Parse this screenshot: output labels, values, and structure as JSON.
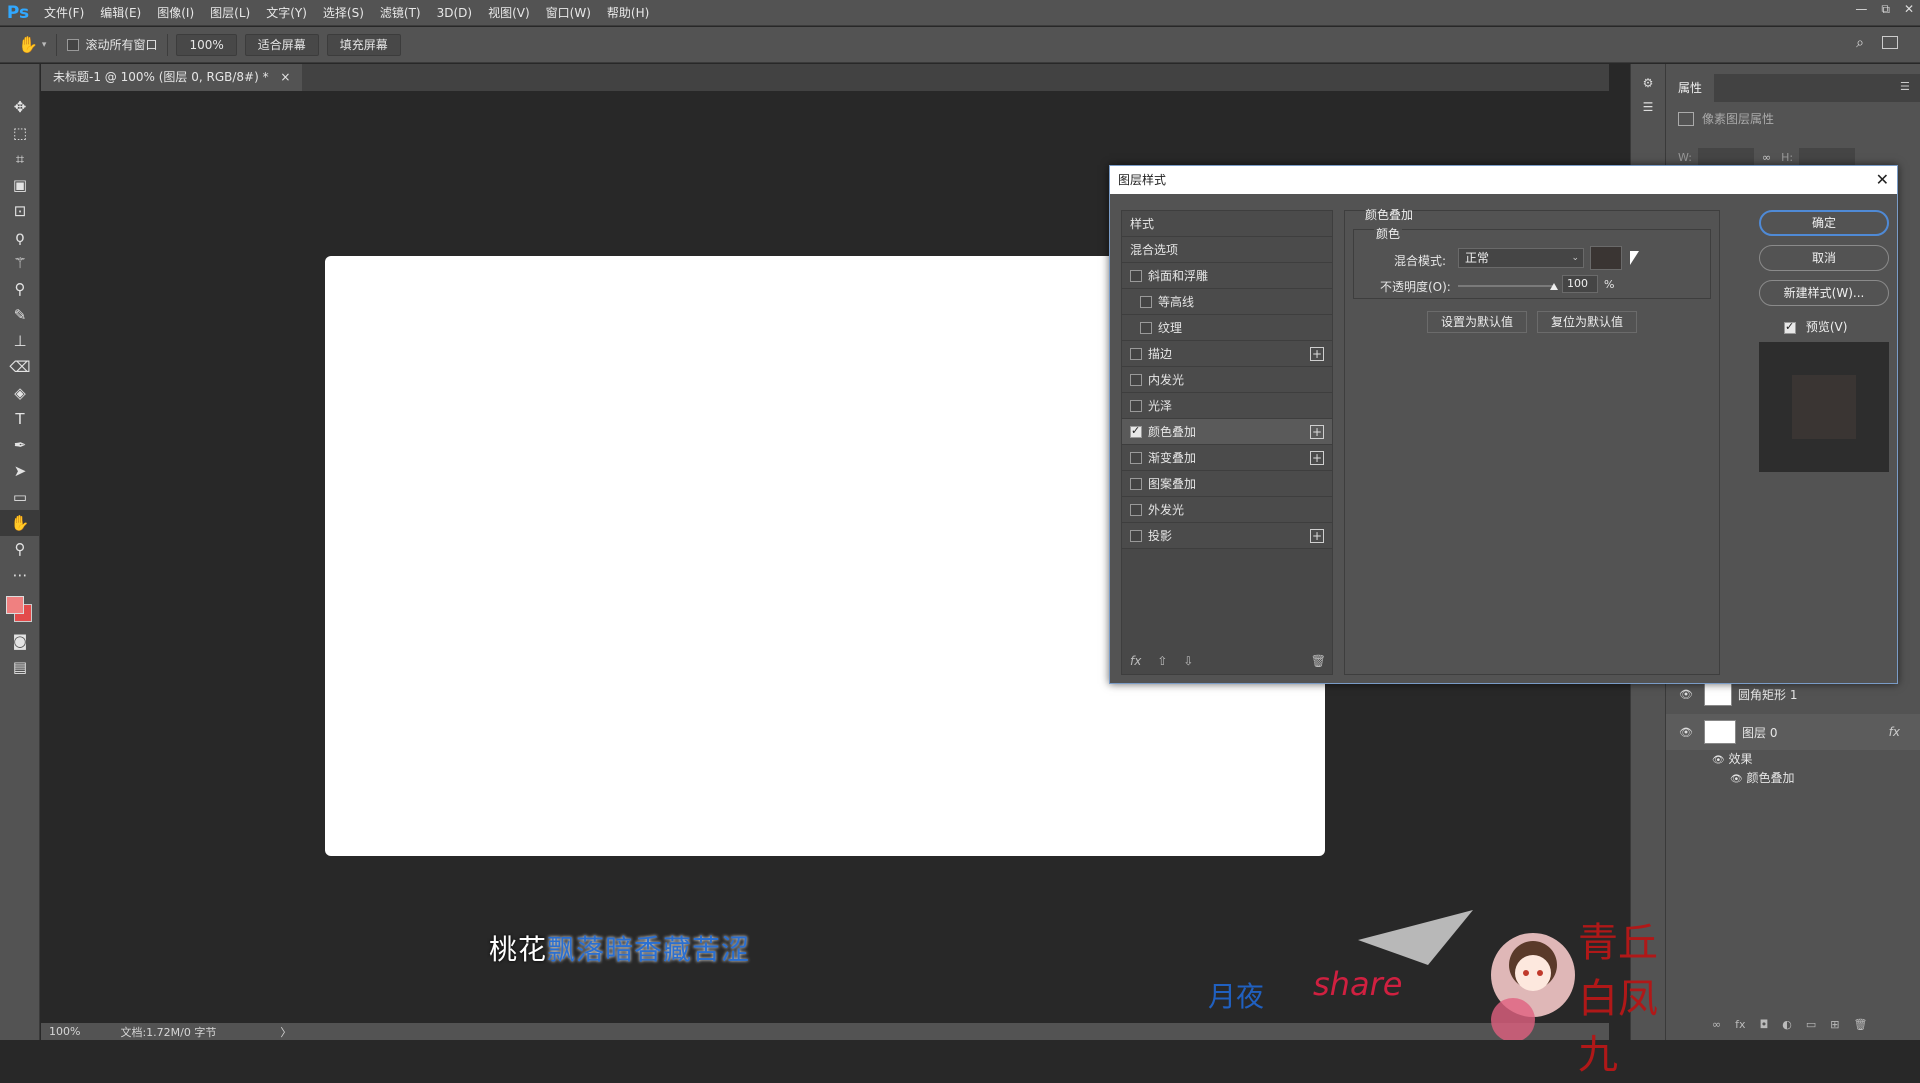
{
  "app": {
    "logo": "Ps"
  },
  "menu": [
    "文件(F)",
    "编辑(E)",
    "图像(I)",
    "图层(L)",
    "文字(Y)",
    "选择(S)",
    "滤镜(T)",
    "3D(D)",
    "视图(V)",
    "窗口(W)",
    "帮助(H)"
  ],
  "window_controls": {
    "minimize": "—",
    "restore": "⧉",
    "close": "✕"
  },
  "options": {
    "scroll_all_label": "滚动所有窗口",
    "zoom_btn": "100%",
    "fit_screen": "适合屏幕",
    "fill_screen": "填充屏幕"
  },
  "document": {
    "tab_title": "未标题-1 @ 100% (图层 0, RGB/8#) *",
    "tab_close": "×"
  },
  "status": {
    "zoom": "100%",
    "doc_info": "文档:1.72M/0 字节",
    "arrow": "〉"
  },
  "properties": {
    "tab": "属性",
    "pixel_layer": "像素图层属性",
    "w_label": "W:",
    "h_label": "H:"
  },
  "layers": [
    {
      "name": "圆角矩形 1"
    },
    {
      "name": "图层 0",
      "fx": "fx"
    }
  ],
  "layer_effects": {
    "effects_label": "效果",
    "effect_item": "颜色叠加"
  },
  "dialog": {
    "title": "图层样式",
    "close": "✕",
    "styles_header": "样式",
    "blend_options": "混合选项",
    "items": [
      {
        "label": "斜面和浮雕",
        "checked": false,
        "indent": false,
        "plus": false
      },
      {
        "label": "等高线",
        "checked": false,
        "indent": true,
        "plus": false
      },
      {
        "label": "纹理",
        "checked": false,
        "indent": true,
        "plus": false
      },
      {
        "label": "描边",
        "checked": false,
        "indent": false,
        "plus": true
      },
      {
        "label": "内发光",
        "checked": false,
        "indent": false,
        "plus": false
      },
      {
        "label": "光泽",
        "checked": false,
        "indent": false,
        "plus": false
      },
      {
        "label": "颜色叠加",
        "checked": true,
        "indent": false,
        "plus": true
      },
      {
        "label": "渐变叠加",
        "checked": false,
        "indent": false,
        "plus": true
      },
      {
        "label": "图案叠加",
        "checked": false,
        "indent": false,
        "plus": false
      },
      {
        "label": "外发光",
        "checked": false,
        "indent": false,
        "plus": false
      },
      {
        "label": "投影",
        "checked": false,
        "indent": false,
        "plus": true
      }
    ],
    "footer": {
      "fx": "fx",
      "up": "⇧",
      "down": "⇩",
      "trash": "🗑"
    },
    "section_title": "颜色叠加",
    "group_title": "颜色",
    "blend_mode_label": "混合模式:",
    "blend_mode_value": "正常",
    "opacity_label": "不透明度(O):",
    "opacity_value": "100",
    "opacity_unit": "%",
    "set_default": "设置为默认值",
    "reset_default": "复位为默认值",
    "ok": "确定",
    "cancel": "取消",
    "new_style": "新建样式(W)...",
    "preview_label": "预览(V)",
    "overlay_color": "#3a3533"
  },
  "subtitle": {
    "white_part": "桃花",
    "blue_part": "飘落暗香藏苦涩"
  },
  "watermark": {
    "left_text": "月夜",
    "share": "share",
    "right_text": "青丘白凤九"
  }
}
